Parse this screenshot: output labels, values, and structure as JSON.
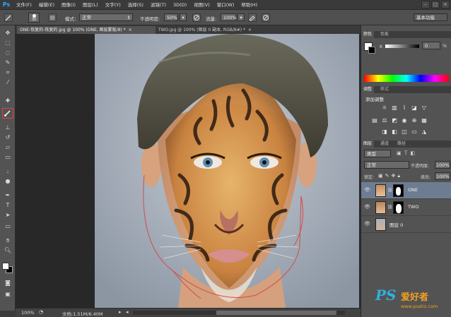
{
  "app": {
    "logo": "Ps"
  },
  "menu": [
    "文件(F)",
    "编辑(E)",
    "图像(I)",
    "图层(L)",
    "文字(Y)",
    "选择(S)",
    "滤镜(T)",
    "3D(D)",
    "视图(V)",
    "窗口(W)",
    "帮助(H)"
  ],
  "window_controls": [
    "–",
    "□",
    "×"
  ],
  "options": {
    "brush_size": "30",
    "mode_label": "模式：",
    "mode_value": "正常",
    "opacity_label": "不透明度:",
    "opacity_value": "50%",
    "flow_label": "流量:",
    "flow_value": "100%",
    "workspace": "基本功能"
  },
  "tabs": [
    {
      "label": "ONE-恢复的-恢复的.jpg @ 100% (ONE, 图层蒙版/8) *",
      "close": "×"
    },
    {
      "label": "TWO.jpg @ 100% (图层 0 副本, RGB/8#) *",
      "close": "×"
    }
  ],
  "status": {
    "zoom": "100%",
    "doc_info": "文档:1.51M/6.40M"
  },
  "panels": {
    "color_tabs": [
      "颜色",
      "色板"
    ],
    "color_channel": "K",
    "color_value": "0",
    "color_unit": "%",
    "adjust_tabs": [
      "调整",
      "样式"
    ],
    "adjust_title": "添加调整",
    "layers_tabs": [
      "图层",
      "通道",
      "路径"
    ],
    "filter_kind": "类型",
    "blend_mode": "正常",
    "opacity_label": "不透明度:",
    "opacity_value": "100%",
    "lock_label": "锁定:",
    "fill_label": "填充:",
    "fill_value": "100%",
    "layers": [
      {
        "name": "ONE",
        "active": true
      },
      {
        "name": "TWO",
        "active": false
      },
      {
        "name": "图层 0",
        "active": false
      }
    ]
  },
  "watermark": {
    "logo": "PS",
    "text": "爱好者",
    "url": "www.psahz.com"
  }
}
